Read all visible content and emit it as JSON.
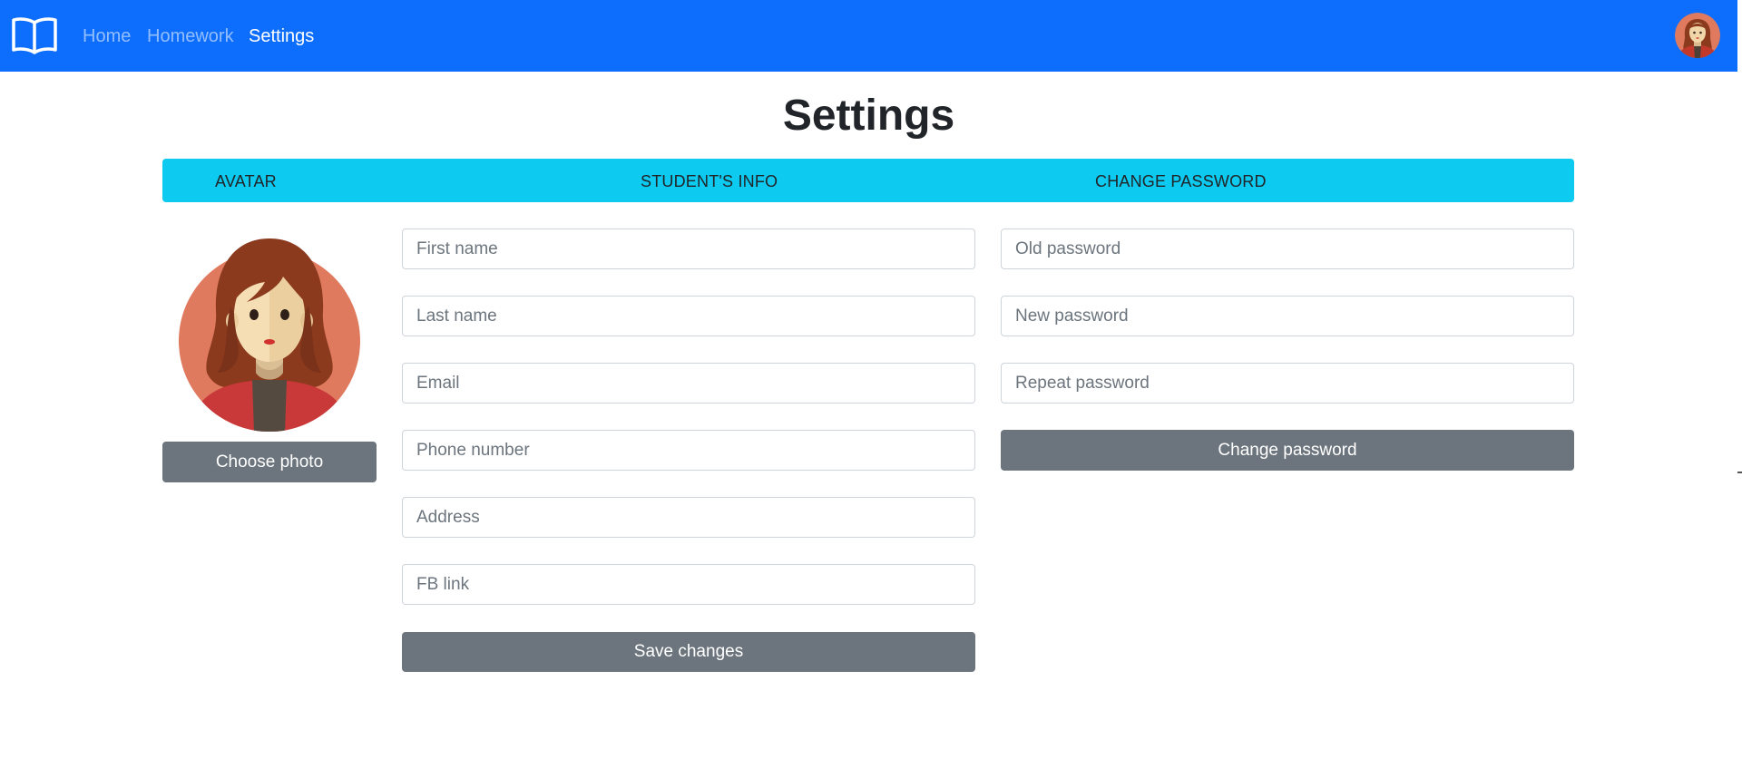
{
  "nav": {
    "brand_icon": "book-open-icon",
    "links": [
      {
        "label": "Home",
        "active": false
      },
      {
        "label": "Homework",
        "active": false
      },
      {
        "label": "Settings",
        "active": true
      }
    ],
    "avatar_icon": "user-avatar-icon"
  },
  "page": {
    "title": "Settings"
  },
  "sections": {
    "avatar": "AVATAR",
    "student_info": "STUDENT'S INFO",
    "change_password": "CHANGE PASSWORD"
  },
  "avatar_panel": {
    "choose_photo_label": "Choose photo"
  },
  "student_form": {
    "first_name_placeholder": "First name",
    "last_name_placeholder": "Last name",
    "email_placeholder": "Email",
    "phone_placeholder": "Phone number",
    "address_placeholder": "Address",
    "fb_link_placeholder": "FB link",
    "save_label": "Save changes"
  },
  "password_form": {
    "old_password_placeholder": "Old password",
    "new_password_placeholder": "New password",
    "repeat_password_placeholder": "Repeat password",
    "change_label": "Change password"
  },
  "colors": {
    "navbar": "#0d6efd",
    "section_bar": "#0dcaf0",
    "button": "#6c757d",
    "input_border": "#ced4da"
  }
}
